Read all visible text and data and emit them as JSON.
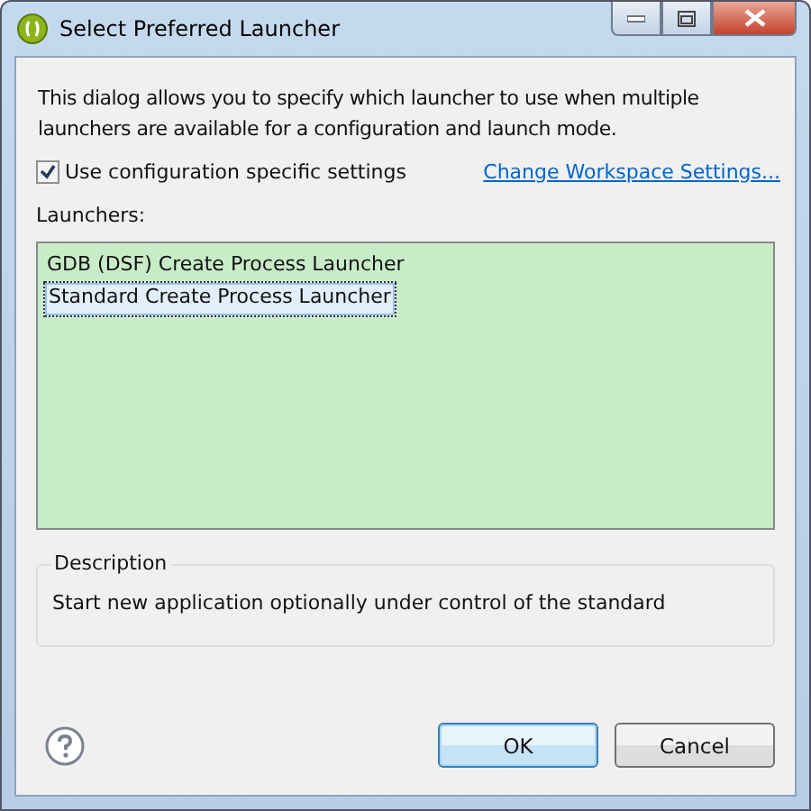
{
  "window": {
    "title": "Select Preferred Launcher"
  },
  "intro": "This dialog allows you to specify which launcher to use when multiple launchers are available for a configuration and launch mode.",
  "use_specific": {
    "label": "Use configuration specific settings",
    "checked": true
  },
  "workspace_link": "Change Workspace Settings...",
  "launchers": {
    "label": "Launchers:",
    "items": [
      {
        "label": "GDB (DSF) Create Process Launcher",
        "selected": false
      },
      {
        "label": "Standard Create Process Launcher",
        "selected": true
      }
    ]
  },
  "description": {
    "title": "Description",
    "text": "Start new application optionally under control of the standard"
  },
  "buttons": [
    {
      "label": "OK",
      "default": true
    },
    {
      "label": "Cancel",
      "default": false
    }
  ]
}
